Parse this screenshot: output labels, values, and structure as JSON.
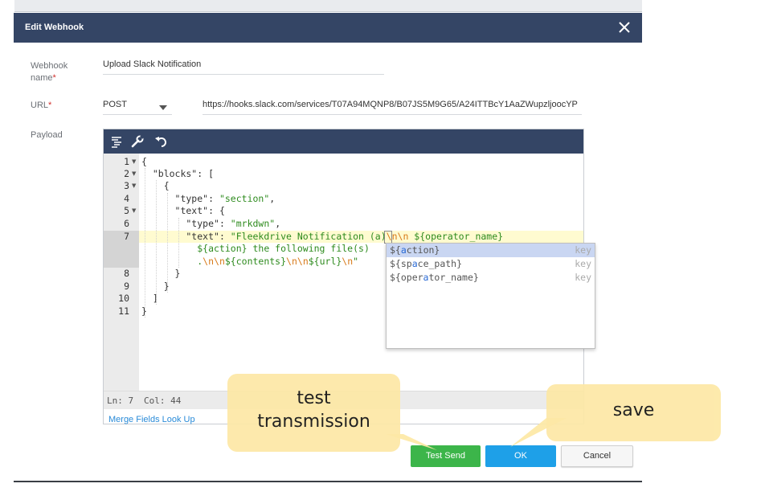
{
  "dialog": {
    "title": "Edit Webhook",
    "close_icon": "close-icon"
  },
  "form": {
    "name_label": "Webhook name",
    "name_required": "*",
    "name_value": "Upload Slack Notification",
    "url_label": "URL",
    "url_required": "*",
    "method_value": "POST",
    "url_value": "https://hooks.slack.com/services/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",
    "payload_label": "Payload"
  },
  "editor": {
    "toolbar_icons": [
      "format-icon",
      "wrench-icon",
      "undo-icon"
    ],
    "line_numbers": [
      "1",
      "2",
      "3",
      "4",
      "5",
      "6",
      "7",
      "8",
      "9",
      "10",
      "11"
    ],
    "status_line": "Ln: 7",
    "status_col": "Col: 44"
  },
  "autocomplete": {
    "items": [
      {
        "value": "${action}",
        "type": "key",
        "selected": true
      },
      {
        "value": "${space_path}",
        "type": "key",
        "selected": false
      },
      {
        "value": "${operator_name}",
        "type": "key",
        "selected": false
      }
    ]
  },
  "footer": {
    "merge_fields_link": "Merge Fields Look Up",
    "test_send_label": "Test Send",
    "ok_label": "OK",
    "cancel_label": "Cancel"
  },
  "annotations": {
    "test_callout_line1": "test",
    "test_callout_line2": "transmission",
    "save_callout": "save"
  },
  "colors": {
    "header": "#344565",
    "test_send": "#3cb54a",
    "ok": "#1ea0e8",
    "callout": "#fde8a6"
  }
}
